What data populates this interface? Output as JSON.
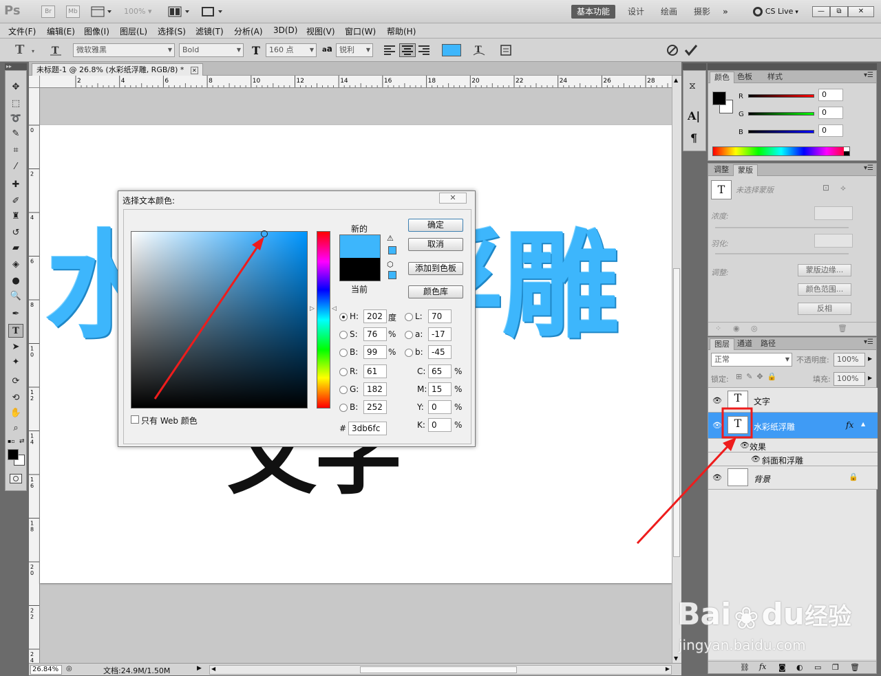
{
  "app": {
    "logo": "Ps",
    "bridge": "Br",
    "minibridge": "Mb",
    "zoom": "100%",
    "workspaces": [
      "基本功能",
      "设计",
      "绘画",
      "摄影"
    ],
    "more": "»",
    "cslive": "CS Live",
    "win_min": "—",
    "win_restore": "⧉",
    "win_close": "✕"
  },
  "menu": [
    "文件(F)",
    "编辑(E)",
    "图像(I)",
    "图层(L)",
    "选择(S)",
    "滤镜(T)",
    "分析(A)",
    "3D(D)",
    "视图(V)",
    "窗口(W)",
    "帮助(H)"
  ],
  "options": {
    "tool_glyph": "T",
    "font_family": "微软雅黑",
    "font_style": "Bold",
    "font_size": "160 点",
    "aa_label": "a",
    "aa_value": "锐利",
    "swatch_color": "#3db6fc"
  },
  "document": {
    "tab_title": "未标题-1 @ 26.8% (水彩纸浮雕, RGB/8) *",
    "canvas_text_top": "水彩纸浮雕",
    "canvas_text_bottom": "文字",
    "ruler_h": [
      "2",
      "4",
      "6",
      "8",
      "10",
      "12",
      "14",
      "16",
      "18",
      "20",
      "22",
      "24",
      "26",
      "28"
    ],
    "ruler_v": [
      "0",
      "2",
      "4",
      "6",
      "8",
      "1\n0",
      "1\n2",
      "1\n4",
      "1\n6",
      "1\n8",
      "2\n0",
      "2\n2",
      "2\n4"
    ],
    "status_zoom": "26.84%",
    "status_doc": "文档:24.9M/1.50M"
  },
  "dialog": {
    "title": "选择文本颜色:",
    "close": "✕",
    "new_label": "新的",
    "current_label": "当前",
    "new_color": "#3db6fc",
    "current_color": "#000000",
    "ok": "确定",
    "cancel": "取消",
    "add_swatch": "添加到色板",
    "color_lib": "颜色库",
    "web_only": "只有 Web 颜色",
    "hsb": [
      {
        "label": "H:",
        "value": "202",
        "unit": "度",
        "on": true
      },
      {
        "label": "S:",
        "value": "76",
        "unit": "%",
        "on": false
      },
      {
        "label": "B:",
        "value": "99",
        "unit": "%",
        "on": false
      }
    ],
    "lab": [
      {
        "label": "L:",
        "value": "70"
      },
      {
        "label": "a:",
        "value": "-17"
      },
      {
        "label": "b:",
        "value": "-45"
      }
    ],
    "rgb": [
      {
        "label": "R:",
        "value": "61"
      },
      {
        "label": "G:",
        "value": "182"
      },
      {
        "label": "B:",
        "value": "252"
      }
    ],
    "cmyk": [
      {
        "label": "C:",
        "value": "65",
        "unit": "%"
      },
      {
        "label": "M:",
        "value": "15",
        "unit": "%"
      },
      {
        "label": "Y:",
        "value": "0",
        "unit": "%"
      },
      {
        "label": "K:",
        "value": "0",
        "unit": "%"
      }
    ],
    "hash": "#",
    "hex": "3db6fc"
  },
  "color_panel": {
    "tabs": [
      "颜色",
      "色板",
      "样式"
    ],
    "channels": [
      {
        "label": "R",
        "value": "0"
      },
      {
        "label": "G",
        "value": "0"
      },
      {
        "label": "B",
        "value": "0"
      }
    ]
  },
  "adjust_panel": {
    "tabs": [
      "调整",
      "蒙版"
    ],
    "no_mask": "未选择蒙版",
    "density": "浓度:",
    "feather": "羽化:",
    "refine": "调整:",
    "mask_edge": "蒙版边缘...",
    "color_range": "颜色范围...",
    "invert": "反相"
  },
  "layers_panel": {
    "tabs": [
      "图层",
      "通道",
      "路径"
    ],
    "blend_mode": "正常",
    "opacity_label": "不透明度:",
    "opacity": "100%",
    "lock_label": "锁定:",
    "fill_label": "填充:",
    "fill": "100%",
    "layers": [
      {
        "name": "文字",
        "thumb": "T",
        "selected": false
      },
      {
        "name": "水彩纸浮雕",
        "thumb": "T",
        "selected": true,
        "fx": "fx"
      },
      {
        "name": "背景",
        "thumb": "",
        "selected": false
      }
    ],
    "effects_label": "效果",
    "effect_item": "斜面和浮雕"
  },
  "watermark": {
    "brand": "Bai",
    "brand2": "du",
    "cn": "经验",
    "url": "jingyan.baidu.com"
  }
}
